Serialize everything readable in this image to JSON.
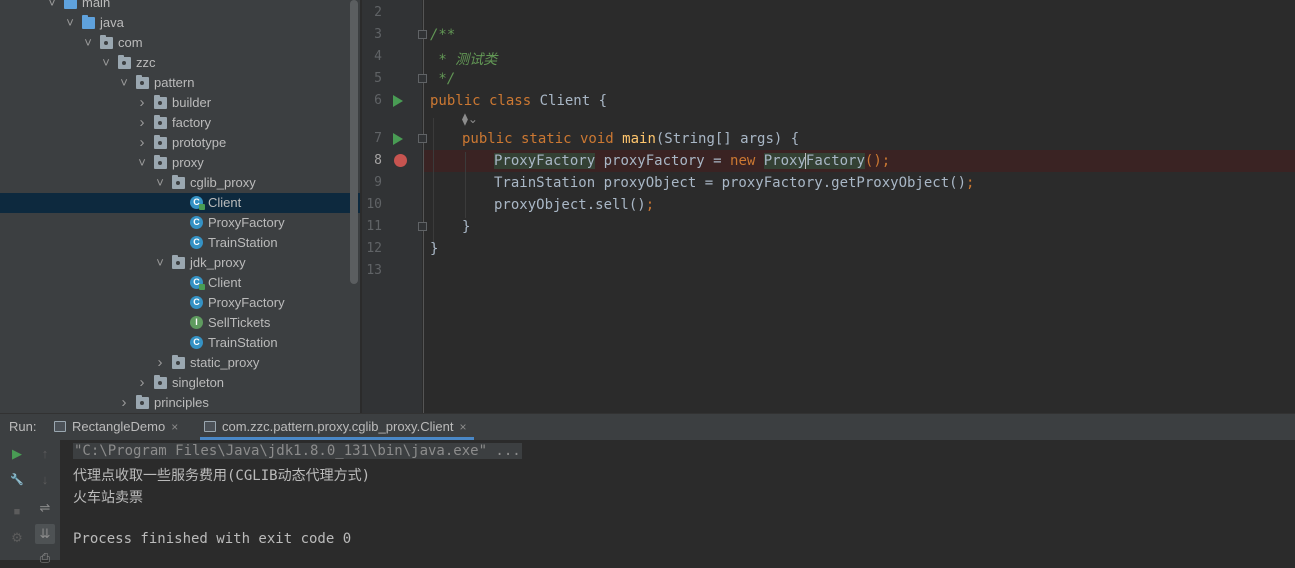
{
  "tree": {
    "items": [
      {
        "label": "main",
        "depth": 0,
        "chevron": "expanded",
        "icon": "folder"
      },
      {
        "label": "java",
        "depth": 1,
        "chevron": "expanded",
        "icon": "source-folder"
      },
      {
        "label": "com",
        "depth": 2,
        "chevron": "expanded",
        "icon": "package"
      },
      {
        "label": "zzc",
        "depth": 3,
        "chevron": "expanded",
        "icon": "package"
      },
      {
        "label": "pattern",
        "depth": 4,
        "chevron": "expanded",
        "icon": "package"
      },
      {
        "label": "builder",
        "depth": 5,
        "chevron": "collapsed",
        "icon": "package"
      },
      {
        "label": "factory",
        "depth": 5,
        "chevron": "collapsed",
        "icon": "package"
      },
      {
        "label": "prototype",
        "depth": 5,
        "chevron": "collapsed",
        "icon": "package"
      },
      {
        "label": "proxy",
        "depth": 5,
        "chevron": "expanded",
        "icon": "package"
      },
      {
        "label": "cglib_proxy",
        "depth": 6,
        "chevron": "expanded",
        "icon": "package"
      },
      {
        "label": "Client",
        "depth": 7,
        "chevron": "none",
        "icon": "class-runnable",
        "selected": true
      },
      {
        "label": "ProxyFactory",
        "depth": 7,
        "chevron": "none",
        "icon": "class"
      },
      {
        "label": "TrainStation",
        "depth": 7,
        "chevron": "none",
        "icon": "class"
      },
      {
        "label": "jdk_proxy",
        "depth": 6,
        "chevron": "expanded",
        "icon": "package"
      },
      {
        "label": "Client",
        "depth": 7,
        "chevron": "none",
        "icon": "class-runnable"
      },
      {
        "label": "ProxyFactory",
        "depth": 7,
        "chevron": "none",
        "icon": "class"
      },
      {
        "label": "SellTickets",
        "depth": 7,
        "chevron": "none",
        "icon": "interface"
      },
      {
        "label": "TrainStation",
        "depth": 7,
        "chevron": "none",
        "icon": "class"
      },
      {
        "label": "static_proxy",
        "depth": 6,
        "chevron": "collapsed",
        "icon": "package"
      },
      {
        "label": "singleton",
        "depth": 5,
        "chevron": "collapsed",
        "icon": "package"
      },
      {
        "label": "principles",
        "depth": 4,
        "chevron": "collapsed",
        "icon": "package"
      }
    ]
  },
  "editor": {
    "line_numbers": [
      "2",
      "3",
      "4",
      "5",
      "6",
      "7",
      "8",
      "9",
      "10",
      "11",
      "12",
      "13"
    ],
    "current_line": "8",
    "lines": {
      "l3": "/**",
      "l4": " * 测试类",
      "l5": " */",
      "l6_kw": "public class",
      "l6_rest": " Client {",
      "l7_kw": "public static void",
      "l7_fn": "main",
      "l7_rest": "(String[] args) {",
      "l8_type": "ProxyFactory",
      "l8_mid": " proxyFactory = ",
      "l8_new": "new",
      "l8_ctor_a": "Proxy",
      "l8_ctor_b": "Factory",
      "l8_end": "();",
      "l9": "TrainStation proxyObject = proxyFactory.getProxyObject()",
      "l9_semi": ";",
      "l10": "proxyObject.sell()",
      "l10_semi": ";",
      "l11": "}",
      "l12": "}"
    },
    "inlay_hint": "⧫⌄"
  },
  "run": {
    "label": "Run:",
    "tabs": [
      {
        "label": "RectangleDemo",
        "close": "×"
      },
      {
        "label": "com.zzc.pattern.proxy.cglib_proxy.Client",
        "close": "×"
      }
    ],
    "console": [
      "\"C:\\Program Files\\Java\\jdk1.8.0_131\\bin\\java.exe\" ...",
      "代理点收取一些服务费用(CGLIB动态代理方式)",
      "火车站卖票",
      "",
      "Process finished with exit code 0"
    ],
    "toolbar": {
      "rerun": "▶",
      "up": "↑",
      "wrench": "🔧",
      "down": "↓",
      "stop": "■",
      "softwrap": "⇌",
      "gear": "⚙",
      "scroll_end": "⇊",
      "print": "⎙"
    }
  },
  "colors": {
    "keyword": "#cc7832",
    "comment": "#629755",
    "method": "#ffc66d",
    "text": "#a9b7c6",
    "accent": "#4a88c7"
  }
}
